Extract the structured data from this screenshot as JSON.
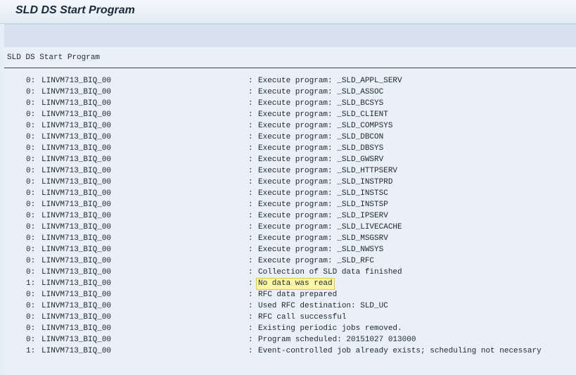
{
  "window": {
    "title": "SLD DS Start Program"
  },
  "content": {
    "heading": "SLD DS Start Program",
    "log": [
      {
        "level": "0:",
        "system": "LINVM713_BIQ_00",
        "sep": ":",
        "message": "Execute program: _SLD_APPL_SERV",
        "highlight": false
      },
      {
        "level": "0:",
        "system": "LINVM713_BIQ_00",
        "sep": ":",
        "message": "Execute program: _SLD_ASSOC",
        "highlight": false
      },
      {
        "level": "0:",
        "system": "LINVM713_BIQ_00",
        "sep": ":",
        "message": "Execute program: _SLD_BCSYS",
        "highlight": false
      },
      {
        "level": "0:",
        "system": "LINVM713_BIQ_00",
        "sep": ":",
        "message": "Execute program: _SLD_CLIENT",
        "highlight": false
      },
      {
        "level": "0:",
        "system": "LINVM713_BIQ_00",
        "sep": ":",
        "message": "Execute program: _SLD_COMPSYS",
        "highlight": false
      },
      {
        "level": "0:",
        "system": "LINVM713_BIQ_00",
        "sep": ":",
        "message": "Execute program: _SLD_DBCON",
        "highlight": false
      },
      {
        "level": "0:",
        "system": "LINVM713_BIQ_00",
        "sep": ":",
        "message": "Execute program: _SLD_DBSYS",
        "highlight": false
      },
      {
        "level": "0:",
        "system": "LINVM713_BIQ_00",
        "sep": ":",
        "message": "Execute program: _SLD_GWSRV",
        "highlight": false
      },
      {
        "level": "0:",
        "system": "LINVM713_BIQ_00",
        "sep": ":",
        "message": "Execute program: _SLD_HTTPSERV",
        "highlight": false
      },
      {
        "level": "0:",
        "system": "LINVM713_BIQ_00",
        "sep": ":",
        "message": "Execute program: _SLD_INSTPRD",
        "highlight": false
      },
      {
        "level": "0:",
        "system": "LINVM713_BIQ_00",
        "sep": ":",
        "message": "Execute program: _SLD_INSTSC",
        "highlight": false
      },
      {
        "level": "0:",
        "system": "LINVM713_BIQ_00",
        "sep": ":",
        "message": "Execute program: _SLD_INSTSP",
        "highlight": false
      },
      {
        "level": "0:",
        "system": "LINVM713_BIQ_00",
        "sep": ":",
        "message": "Execute program: _SLD_IPSERV",
        "highlight": false
      },
      {
        "level": "0:",
        "system": "LINVM713_BIQ_00",
        "sep": ":",
        "message": "Execute program: _SLD_LIVECACHE",
        "highlight": false
      },
      {
        "level": "0:",
        "system": "LINVM713_BIQ_00",
        "sep": ":",
        "message": "Execute program: _SLD_MSGSRV",
        "highlight": false
      },
      {
        "level": "0:",
        "system": "LINVM713_BIQ_00",
        "sep": ":",
        "message": "Execute program: _SLD_NWSYS",
        "highlight": false
      },
      {
        "level": "0:",
        "system": "LINVM713_BIQ_00",
        "sep": ":",
        "message": "Execute program: _SLD_RFC",
        "highlight": false
      },
      {
        "level": "0:",
        "system": "LINVM713_BIQ_00",
        "sep": ":",
        "message": "Collection of SLD data finished",
        "highlight": false
      },
      {
        "level": "1:",
        "system": "LINVM713_BIQ_00",
        "sep": ":",
        "message": "No data was read",
        "highlight": true
      },
      {
        "level": "0:",
        "system": "LINVM713_BIQ_00",
        "sep": ":",
        "message": "RFC data prepared",
        "highlight": false
      },
      {
        "level": "0:",
        "system": "LINVM713_BIQ_00",
        "sep": ":",
        "message": "Used RFC destination: SLD_UC",
        "highlight": false
      },
      {
        "level": "0:",
        "system": "LINVM713_BIQ_00",
        "sep": ":",
        "message": "RFC call successful",
        "highlight": false
      },
      {
        "level": "0:",
        "system": "LINVM713_BIQ_00",
        "sep": ":",
        "message": "Existing periodic jobs removed.",
        "highlight": false
      },
      {
        "level": "0:",
        "system": "LINVM713_BIQ_00",
        "sep": ":",
        "message": "Program scheduled: 20151027 013000",
        "highlight": false
      },
      {
        "level": "1:",
        "system": "LINVM713_BIQ_00",
        "sep": ":",
        "message": "Event-controlled job already exists; scheduling not necessary",
        "highlight": false
      }
    ]
  },
  "colors": {
    "highlight_bg": "#fff6a8",
    "highlight_border": "#e8c64a",
    "text": "#1c2733"
  }
}
